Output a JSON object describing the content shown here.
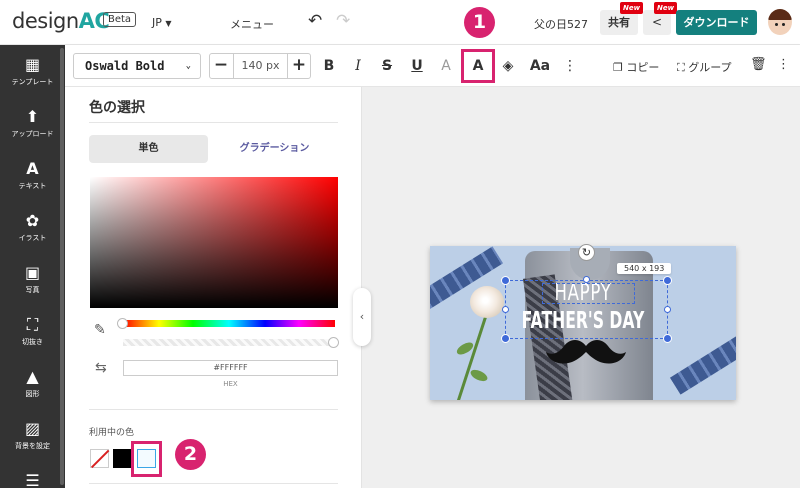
{
  "header": {
    "logo_text": "design",
    "logo_ac": "AC",
    "beta": "Beta",
    "lang": "JP",
    "menu": "メニュー",
    "project": "父の日527",
    "share": "共有",
    "new_badge": "New",
    "download": "ダウンロード"
  },
  "sidebar": {
    "items": [
      {
        "label": "テンプレート",
        "icon": "template-icon"
      },
      {
        "label": "アップロード",
        "icon": "upload-icon"
      },
      {
        "label": "テキスト",
        "icon": "text-icon"
      },
      {
        "label": "イラスト",
        "icon": "illustration-icon"
      },
      {
        "label": "写真",
        "icon": "photo-icon"
      },
      {
        "label": "切抜き",
        "icon": "crop-icon"
      },
      {
        "label": "図形",
        "icon": "shape-icon"
      },
      {
        "label": "背景を設定",
        "icon": "background-icon"
      }
    ]
  },
  "toolbar": {
    "font": "Oswald Bold",
    "size": "140 px",
    "copy": "コピー",
    "group": "グループ"
  },
  "panel": {
    "title": "色の選択",
    "tab_solid": "単色",
    "tab_gradient": "グラデーション",
    "hex_value": "#FFFFFF",
    "hex_label": "HEX",
    "used_colors_label": "利用中の色"
  },
  "canvas": {
    "dims": "540 x 193",
    "line1": "HAPPY",
    "line2": "FATHER'S DAY"
  },
  "annotations": {
    "step1": "1",
    "step2": "2"
  },
  "colors": {
    "accent_teal": "#14807e",
    "highlight": "#d8236f",
    "sidebar_bg": "#333333"
  }
}
